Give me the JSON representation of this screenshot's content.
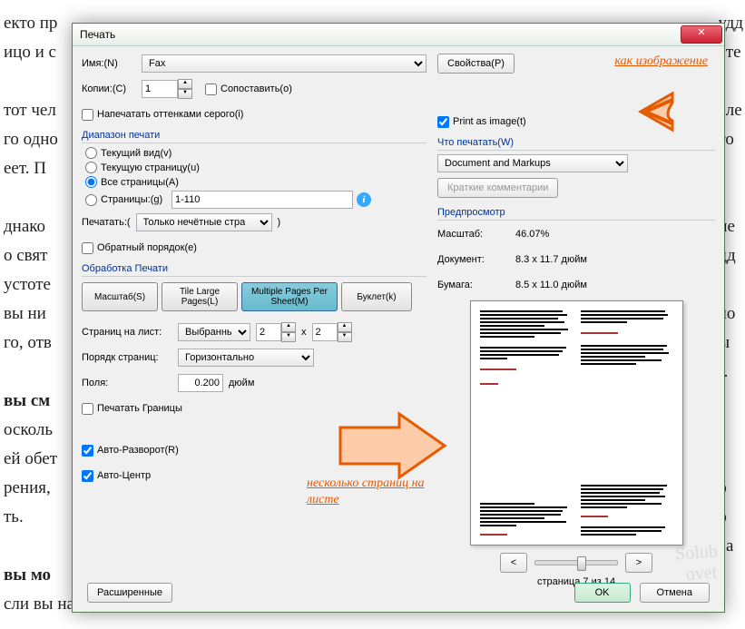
{
  "title": "Печать",
  "name_lbl": "Имя:(N)",
  "printer": "Fax",
  "props_btn": "Свойства(P)",
  "copies_lbl": "Копии:(C)",
  "copies_val": "1",
  "collate": "Сопоставить(o)",
  "grayscale": "Напечатать оттенками серого(i)",
  "print_as_image": "Print as image(t)",
  "range_grp": "Диапазон печати",
  "r_view": "Текущий вид(v)",
  "r_page": "Текущую страницу(u)",
  "r_all": "Все страницы(A)",
  "r_pages": "Страницы:(g)",
  "pages_val": "1-110",
  "print_lbl": "Печатать:(",
  "subset": "Только нечётные стра",
  "reverse": "Обратный порядок(e)",
  "handling_grp": "Обработка Печати",
  "tab_scale": "Масштаб(S)",
  "tab_tile": "Tile Large Pages(L)",
  "tab_multi": "Multiple Pages Per Sheet(M)",
  "tab_booklet": "Буклет(k)",
  "ppsheet_lbl": "Страниц на лист:",
  "ppsheet_val": "Выбранные",
  "pp_x": "2",
  "pp_y": "2",
  "order_lbl": "Порядк страниц:",
  "order_val": "Горизонтально",
  "margins_lbl": "Поля:",
  "margins_val": "0.200",
  "margins_unit": "дюйм",
  "print_border": "Печатать Границы",
  "auto_rotate": "Авто-Разворот(R)",
  "auto_center": "Авто-Центр",
  "advanced_btn": "Расширенные",
  "what_grp": "Что печатать(W)",
  "what_val": "Document and Markups",
  "brief_btn": "Краткие комментарии",
  "preview_grp": "Предпросмотр",
  "scale_lbl": "Масштаб:",
  "scale_val": "46.07%",
  "doc_lbl": "Документ:",
  "doc_val": "8.3 x 11.7 дюйм",
  "paper_lbl": "Бумага:",
  "paper_val": "8.5 x 11.0 дюйм",
  "nav_prev": "<",
  "nav_next": ">",
  "page_indicator": "страница 7 из 14",
  "ok_btn": "OK",
  "cancel_btn": "Отмена",
  "annot1": "как изображение",
  "annot2": "несколько страниц на листе",
  "bg1": "екто пр",
  "bg2": "ицо и с",
  "bg3": "тот чел",
  "bg4": "го одно",
  "bg5": "еет. П",
  "bg6": "днако",
  "bg7": "о свят",
  "bg8": "устоте",
  "bg9": "вы ни",
  "bg10": "го, отв",
  "bg11": "вы см",
  "bg12": "осколь",
  "bg13": "ей обет",
  "bg14": "рения,",
  "bg15": "ть.",
  "bg16": "вы мо",
  "bg17": "сли вы найдёте ответ на эту задачу, то вы найдёте истинный путь.",
  "bgr1": "удд",
  "bgr2": "ете",
  "bgr3": "еле",
  "bgr4": "то",
  "bgr5": "ие",
  "bgr6": "дд",
  "bgr7": "ло",
  "bgr8": "ы",
  "bgr9": ").",
  "bgr10": "р",
  "bgr11": "о",
  "bgr12": "са"
}
